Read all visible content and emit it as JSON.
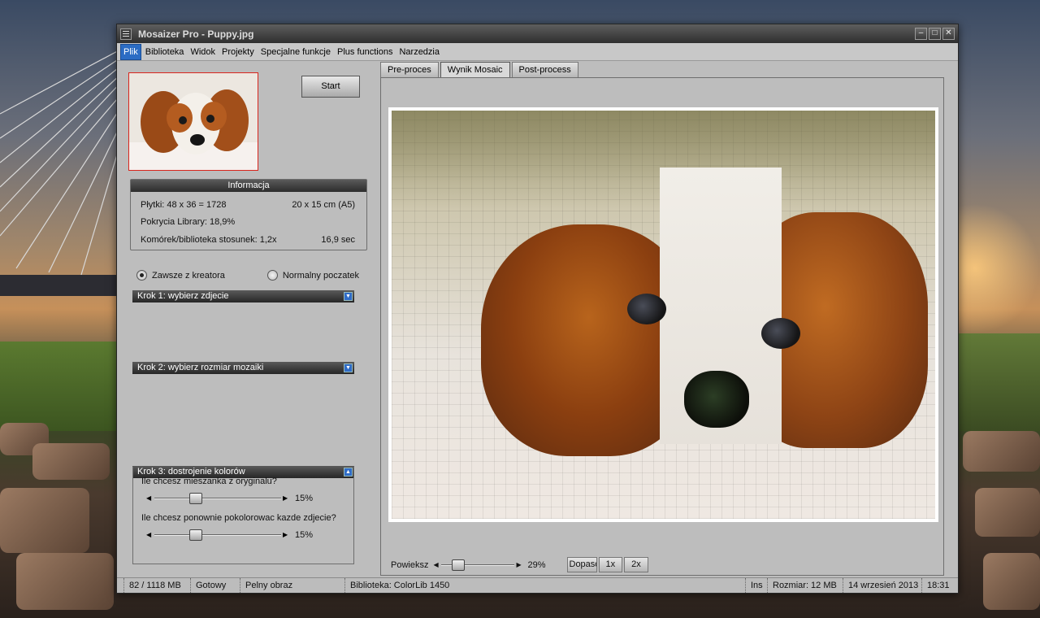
{
  "window": {
    "title": "Mosaizer Pro - Puppy.jpg",
    "controls": [
      "–",
      "□",
      "✕"
    ]
  },
  "menu": [
    "Plik",
    "Biblioteka",
    "Widok",
    "Projekty",
    "Specjalne funkcje",
    "Plus functions",
    "Narzedzia"
  ],
  "left": {
    "start_label": "Start",
    "info": {
      "title": "Informacja",
      "tiles": "Płytki: 48 x 36 = 1728",
      "size": "20 x 15 cm  (A5)",
      "coverage": "Pokrycia Library: 18,9%",
      "ratio": "Komórek/biblioteka stosunek: 1,2x",
      "time": "16,9 sec"
    },
    "radio_wizard": "Zawsze z kreatora",
    "radio_normal": "Normalny poczatek",
    "step1": "Krok 1: wybierz zdjecie",
    "step2": "Krok 2: wybierz rozmiar mozaiki",
    "step3": "Krok 3: dostrojenie kolorów",
    "q1": "Ile chcesz mieszanka z oryginalu?",
    "q1_value": "15%",
    "q1_fraction": 0.15,
    "q2": "Ile chcesz ponownie pokolorowac kazde zdjecie?",
    "q2_value": "15%",
    "q2_fraction": 0.15
  },
  "tabs": [
    "Pre-proces",
    "Wynik Mosaic",
    "Post-process"
  ],
  "active_tab": "Wynik Mosaic",
  "zoom": {
    "label": "Powieksz",
    "value": "29%",
    "fraction": 0.29,
    "fit_label": "Dopasowa",
    "btn_1x": "1x",
    "btn_2x": "2x"
  },
  "status": {
    "memory": "82 / 1118 MB",
    "state": "Gotowy",
    "view": "Pelny obraz",
    "library": "Biblioteka: ColorLib 1450",
    "ins": "Ins",
    "size": "Rozmiar:  12 MB",
    "date": "14 wrzesień 2013",
    "time": "18:31"
  },
  "colors": {
    "accent": "#2b6cc4",
    "thumb_border": "#d9251c",
    "panel_head": "#2c2c2c"
  }
}
